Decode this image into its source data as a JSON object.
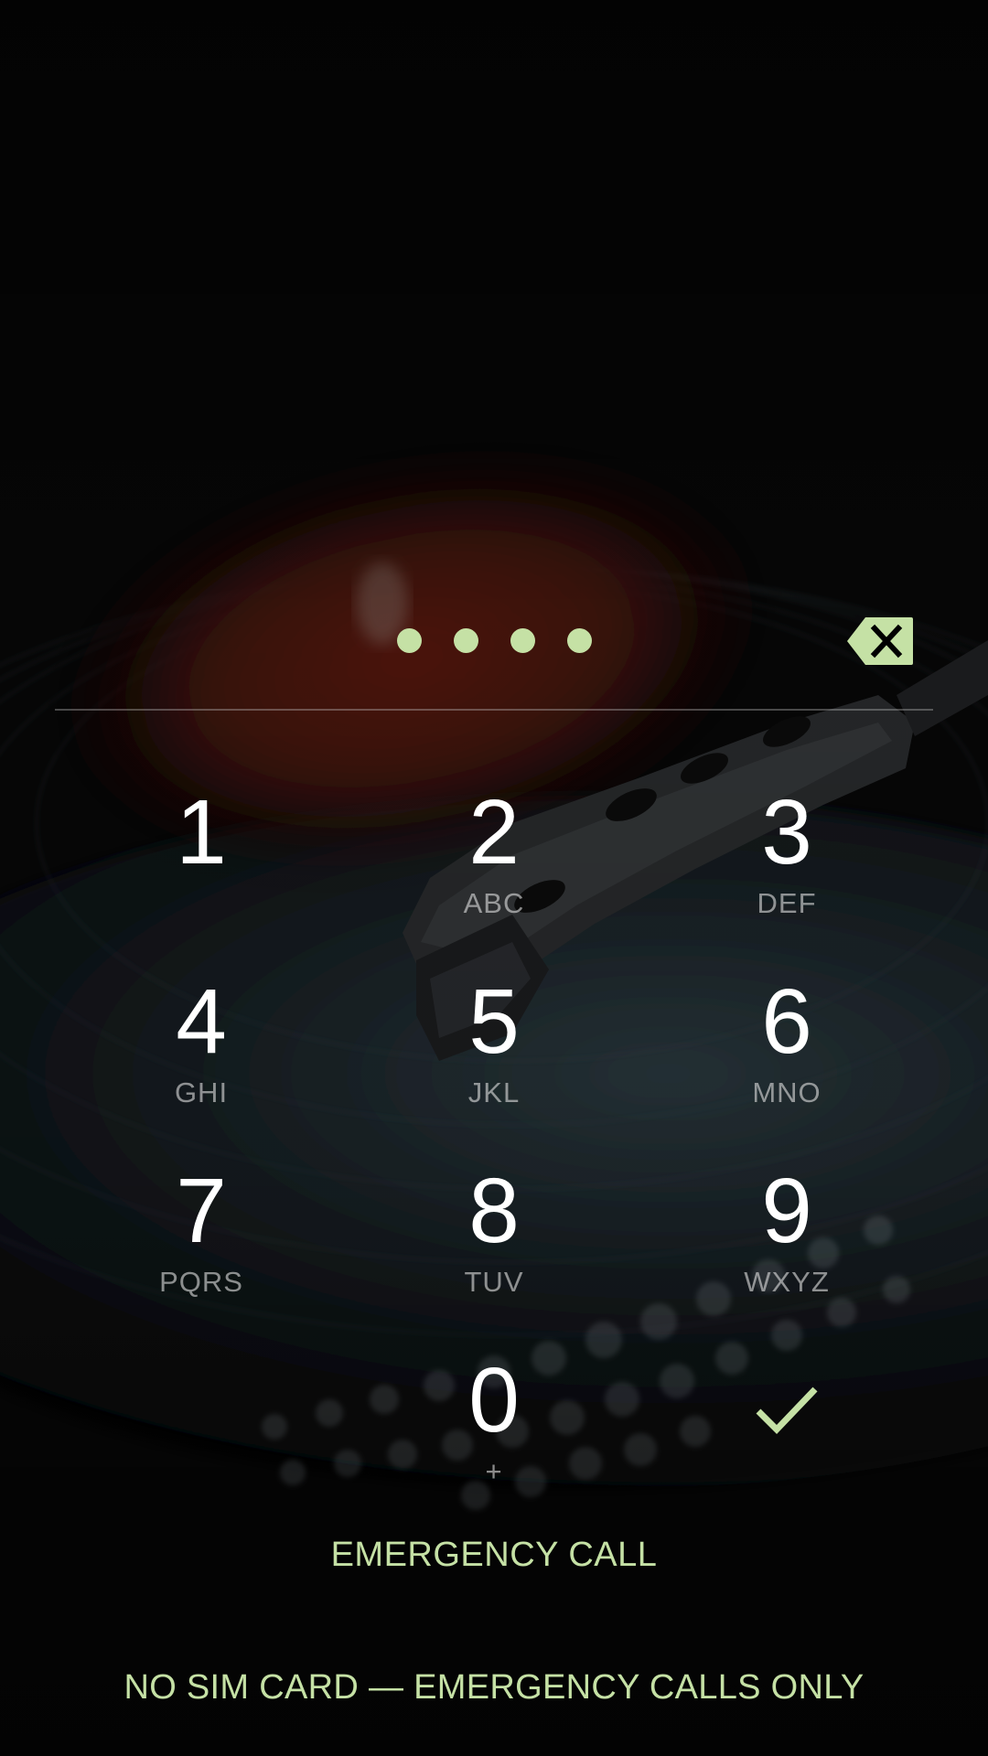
{
  "pin": {
    "entered_count": 4,
    "dot_color": "#c5e1a5",
    "backspace_icon": "backspace-icon"
  },
  "keypad": {
    "keys": [
      {
        "digit": "1",
        "letters": ""
      },
      {
        "digit": "2",
        "letters": "ABC"
      },
      {
        "digit": "3",
        "letters": "DEF"
      },
      {
        "digit": "4",
        "letters": "GHI"
      },
      {
        "digit": "5",
        "letters": "JKL"
      },
      {
        "digit": "6",
        "letters": "MNO"
      },
      {
        "digit": "7",
        "letters": "PQRS"
      },
      {
        "digit": "8",
        "letters": "TUV"
      },
      {
        "digit": "9",
        "letters": "WXYZ"
      },
      {
        "digit": "0",
        "letters": "+"
      }
    ],
    "enter_icon": "check-icon"
  },
  "emergency_call_label": "EMERGENCY CALL",
  "carrier_text": "NO SIM CARD — EMERGENCY CALLS ONLY",
  "colors": {
    "accent": "#c5e1a5",
    "digit": "#ffffff",
    "background": "#060606"
  }
}
